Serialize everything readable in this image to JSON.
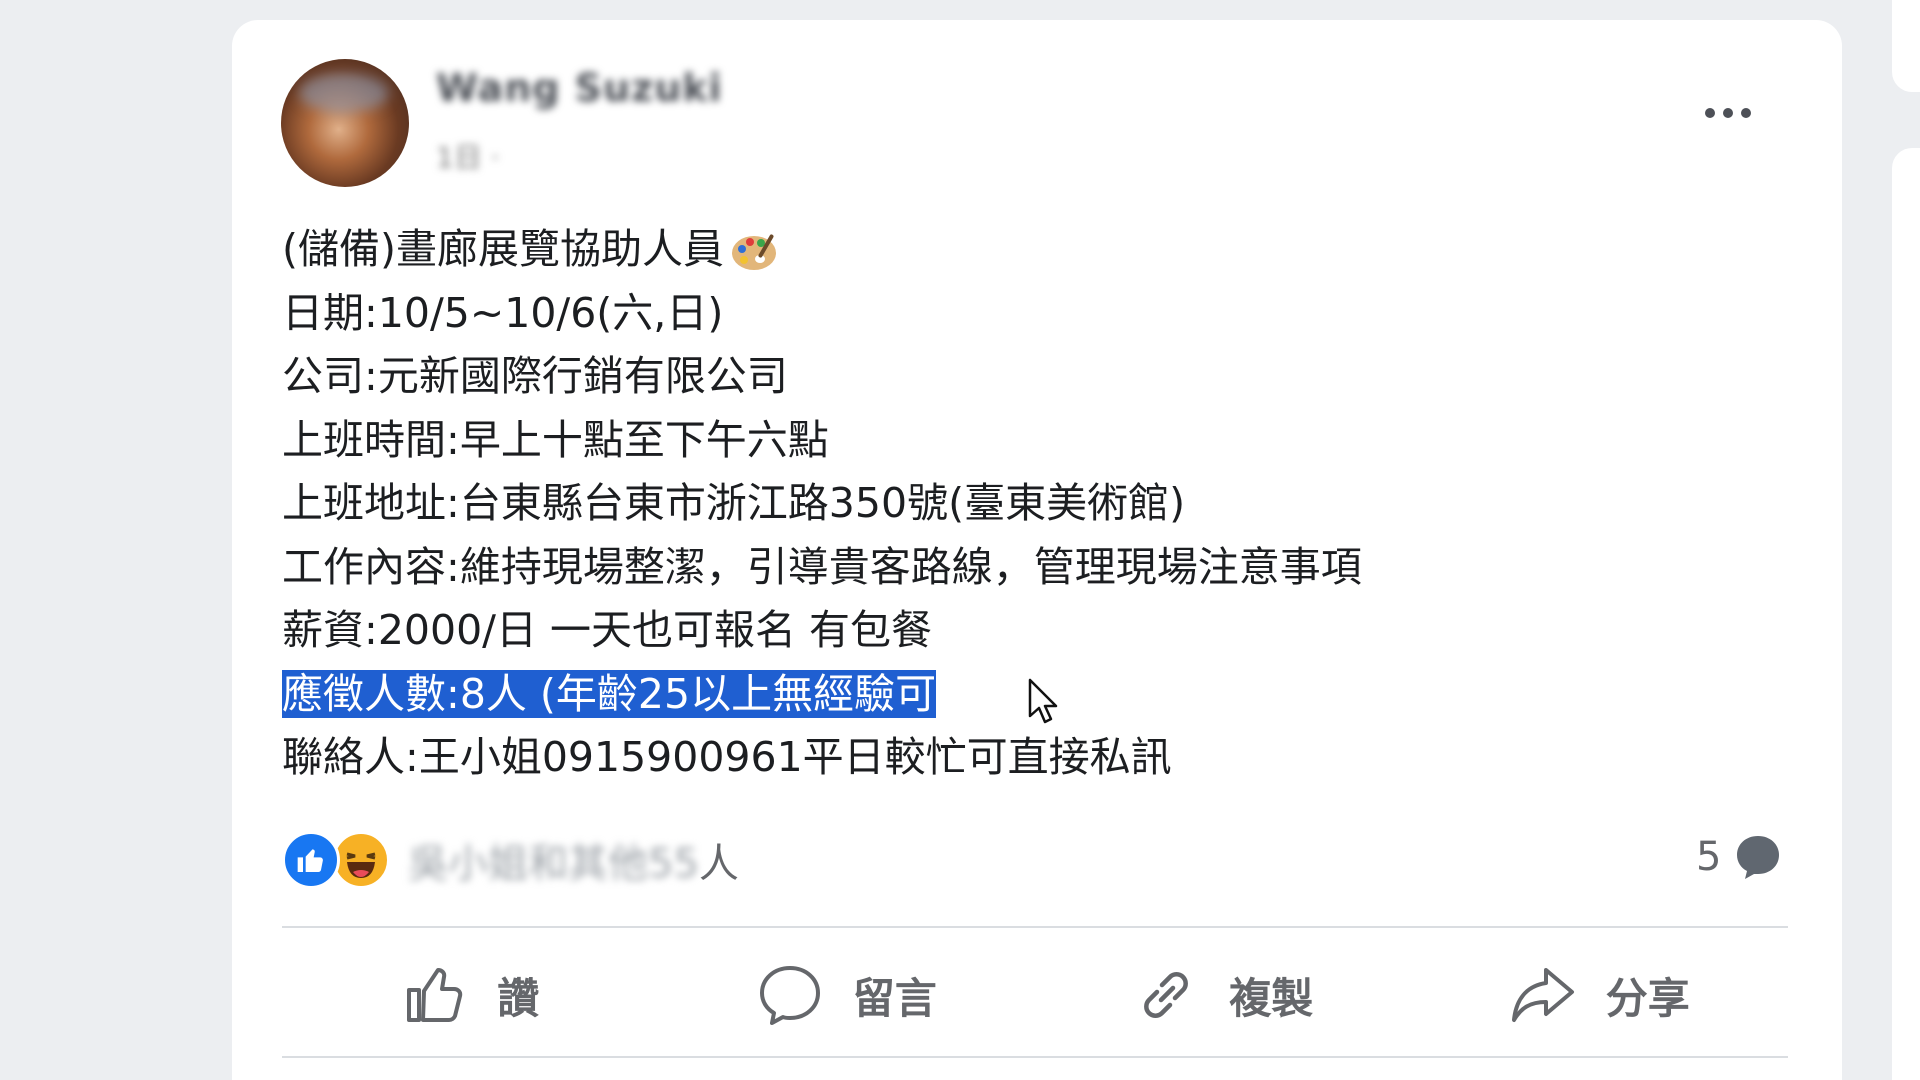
{
  "post": {
    "author_name": "Wang Suzuki",
    "timestamp": "1日 ·",
    "lines": [
      "(儲備)畫廊展覽協助人員",
      "日期:10/5~10/6(六,日)",
      "公司:元新國際行銷有限公司",
      "上班時間:早上十點至下午六點",
      "上班地址:台東縣台東市浙江路350號(臺東美術館)",
      "工作內容:維持現場整潔，引導貴客路線，管理現場注意事項",
      "薪資:2000/日 一天也可報名 有包餐",
      "應徵人數:8人 (年齡25以上無經驗可",
      "聯絡人:王小姐0915900961平日較忙可直接私訊"
    ],
    "highlighted_line_index": 7,
    "title_emoji": "artist-palette-icon"
  },
  "reactions": {
    "names_blurred": "吳小姐和其他55",
    "suffix": "人",
    "comment_count": "5"
  },
  "actions": {
    "like": "讚",
    "comment": "留言",
    "copy": "複製",
    "share": "分享"
  },
  "colors": {
    "highlight": "#1f5fd1",
    "like_blue": "#1877f2",
    "haha_yellow": "#f7b125"
  }
}
